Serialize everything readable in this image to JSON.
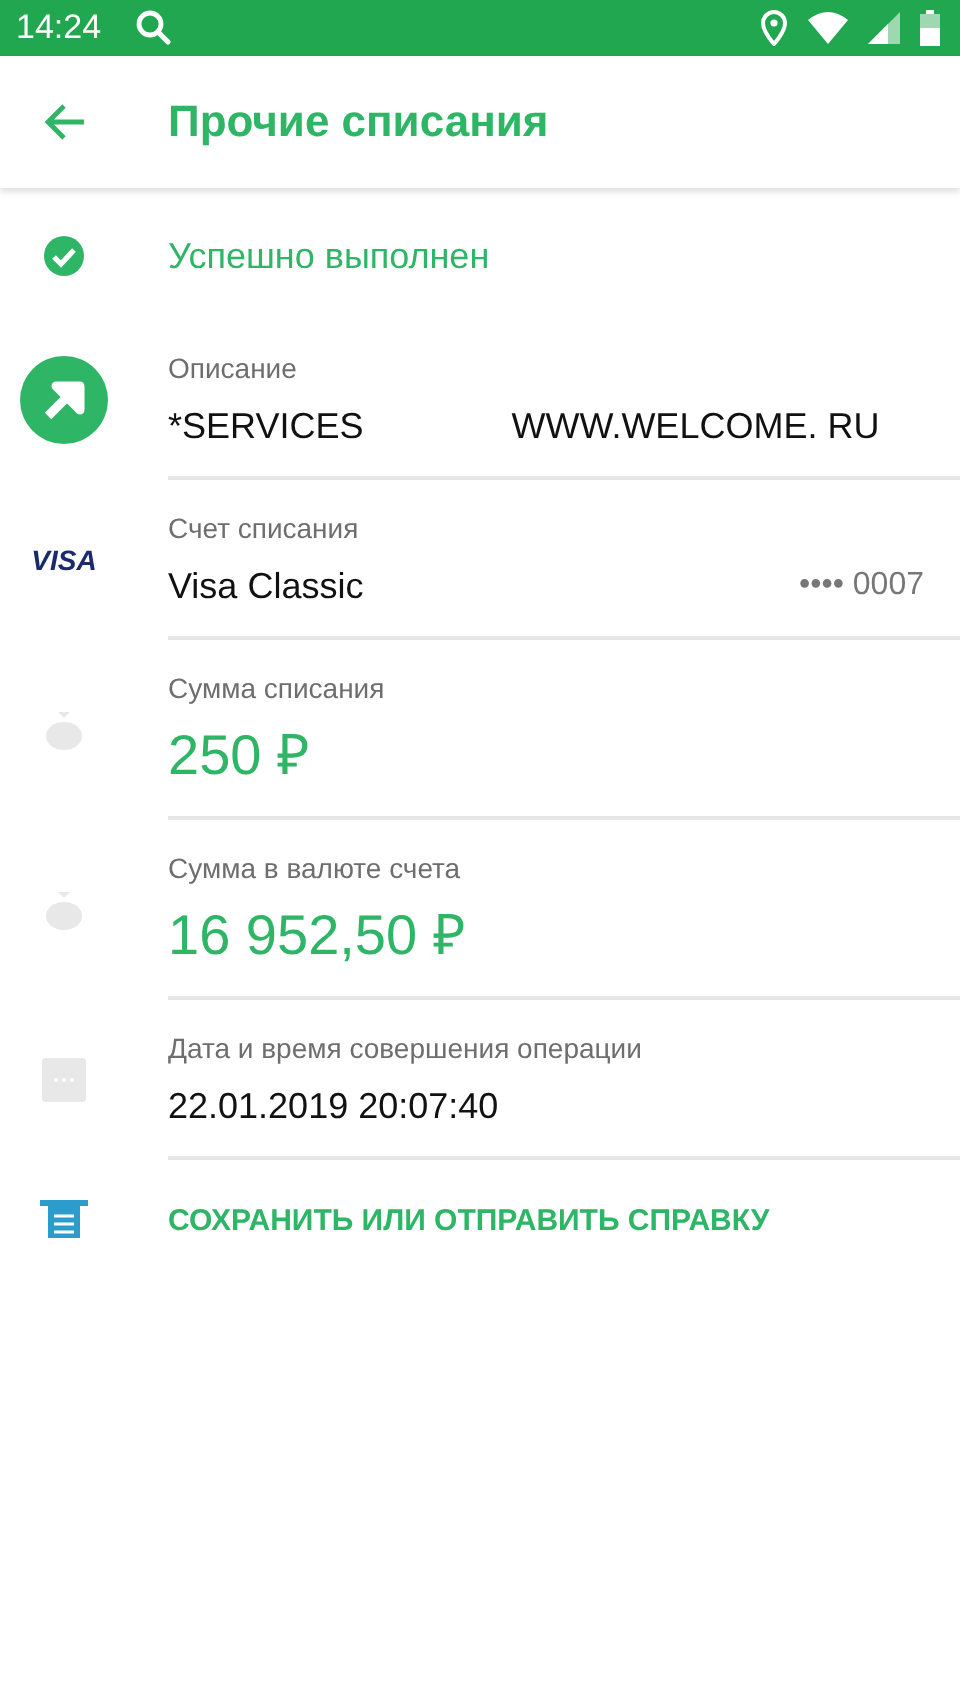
{
  "status_bar": {
    "time": "14:24"
  },
  "header": {
    "title": "Прочие списания"
  },
  "status": {
    "text": "Успешно выполнен"
  },
  "fields": [
    {
      "kind": "description",
      "label": "Описание",
      "value": "*SERVICES",
      "value_2": "WWW.WELCOME. RU"
    },
    {
      "kind": "account",
      "icon_text": "VISA",
      "label": "Счет списания",
      "value": "Visa Classic",
      "trailing": "•••• 0007"
    },
    {
      "kind": "amount",
      "label": "Сумма списания",
      "value": "250 ₽"
    },
    {
      "kind": "amount",
      "label": "Сумма в валюте счета",
      "value": "16 952,50 ₽"
    },
    {
      "kind": "datetime",
      "label": "Дата и время совершения операции",
      "value": "22.01.2019 20:07:40"
    }
  ],
  "action": {
    "label": "СОХРАНИТЬ ИЛИ ОТПРАВИТЬ СПРАВКУ"
  }
}
